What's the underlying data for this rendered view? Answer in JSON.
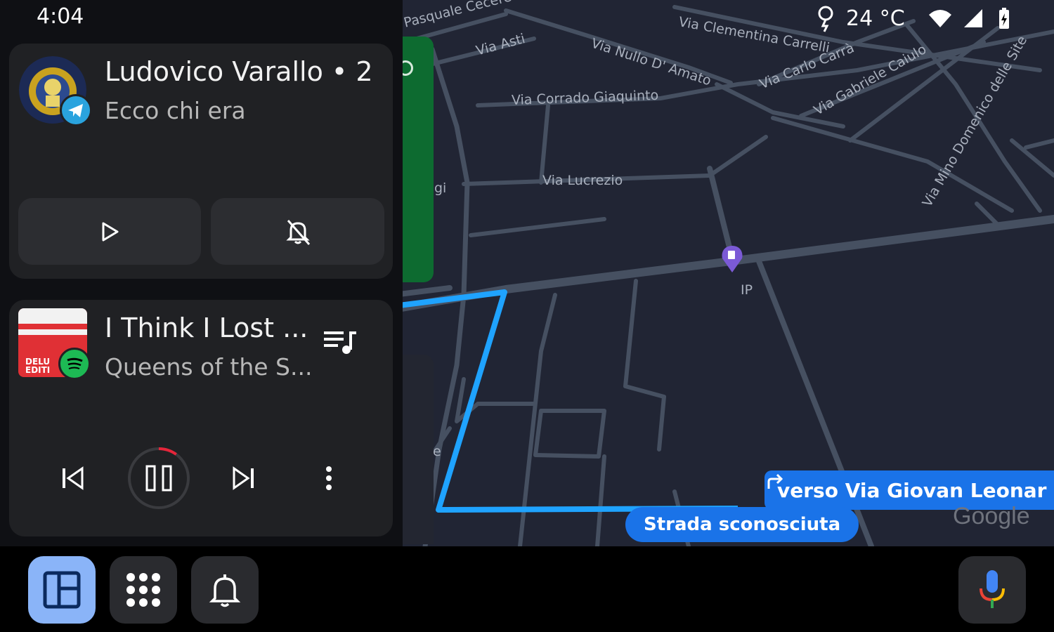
{
  "status": {
    "time": "4:04",
    "temperature": "24 °C"
  },
  "message_card": {
    "sender": "Ludovico Varallo • 2",
    "preview": "Ecco chi era",
    "app_badge_icon": "telegram-icon",
    "actions": [
      {
        "icon": "play-icon"
      },
      {
        "icon": "mute-notifications-icon"
      }
    ]
  },
  "media_card": {
    "track_title": "I Think I Lost ...",
    "artist": "Queens of the S...",
    "album_art_text": "DELU EDITI",
    "app_badge_icon": "spotify-icon",
    "progress_fraction": 0.1,
    "controls": [
      "previous-icon",
      "pause-icon",
      "next-icon",
      "more-vert-icon"
    ]
  },
  "map": {
    "streets": [
      "Pasquale Cecere",
      "Via Asti",
      "Via Nullo D' Amato",
      "Via Clementina Carrelli",
      "Via Carlo Carrà",
      "Via Gabriele Caiulo",
      "Via Mino Domenico delle Site",
      "Via Corrado Giaquinto",
      "Via Lucrezio",
      "gi",
      "e"
    ],
    "poi_label": "IP",
    "turn_instruction": "verso Via Giovan Leonar",
    "current_street": "Strada sconosciuta",
    "logo": "Google"
  },
  "colors": {
    "route": "#1fa3ff",
    "accent": "#1a73e8",
    "launcher_active": "#8ab4f8",
    "progress": "#e5253a"
  },
  "dock": {
    "buttons": [
      "dashboard-icon",
      "app-grid-icon",
      "notifications-bell-icon",
      "assistant-mic-icon"
    ]
  }
}
